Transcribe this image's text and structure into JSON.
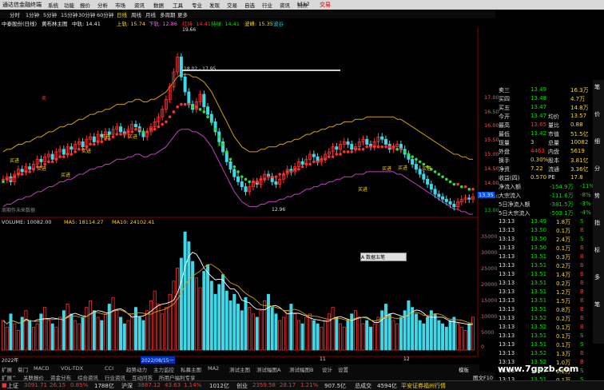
{
  "window": {
    "title": "通达信金融终端",
    "right_label": "交易",
    "menus": [
      "系统",
      "功能",
      "报价",
      "分析",
      "市场",
      "资讯",
      "数据",
      "工具",
      "专业",
      "发现",
      "交易",
      "自选",
      "行业",
      "资讯",
      "热点",
      "L1L2"
    ]
  },
  "periods": [
    "分时",
    "1分钟",
    "5分钟",
    "15分钟",
    "30分钟",
    "60分钟",
    "日线",
    "周线",
    "月线",
    "多周期",
    "更多"
  ],
  "stock_header": {
    "name": "中泰股份(日线)",
    "indicator": "黄布林主图",
    "mid_label": "中轨: 14.41",
    "upper_label": "上轨: 15.74",
    "lower_label": "下轨: 12.86",
    "red_label": "红持: 14.41",
    "green_label": "持绿: 14.41",
    "wave_label": "波峰: 15.35",
    "extra_label": "波谷"
  },
  "price_axis": [
    "17.00",
    "16.50",
    "16.00",
    "15.50",
    "15.00",
    "14.50",
    "14.00",
    "13.50",
    "13.00"
  ],
  "current_price_tag": "13.35",
  "annotations": {
    "high": "19.66",
    "range": "18.02 - 17.95",
    "low": "12.96",
    "buy_labels": [
      "买进",
      "买进",
      "买进",
      "买进",
      "买进",
      "买进",
      "买进",
      "买进",
      "买进",
      "买进"
    ],
    "sell_labels": [
      "卖",
      "卖"
    ],
    "note": "周期作未来数据"
  },
  "volume_header": {
    "volume": "VOLUME: 10082.00",
    "ma5": "MA5: 18114.27",
    "ma10": "MA10: 24102.41"
  },
  "volume_axis": [
    "35000",
    "30000",
    "25000",
    "20000",
    "15000",
    "10000",
    "5000",
    "0"
  ],
  "date_labels": {
    "left": "2022年",
    "middle": "2022/08/15一",
    "m2": "11",
    "m3": "12"
  },
  "popup": "A 数据五笔",
  "chart_data": {
    "type": "bar",
    "title": "",
    "categories": [],
    "ylabel": "",
    "ylim": [
      0,
      38000
    ],
    "series": [
      {
        "name": "VOLUME",
        "values": [
          9000,
          7000,
          11000,
          8000,
          6000,
          10000,
          12000,
          9000,
          7000,
          8000,
          11000,
          13000,
          9000,
          8000,
          7000,
          10000,
          12000,
          14000,
          11000,
          9000,
          8000,
          10000,
          13000,
          15000,
          12000,
          10000,
          9000,
          11000,
          14000,
          16000,
          12000,
          10000,
          8000,
          9000,
          11000,
          13000,
          10000,
          9000,
          12000,
          15000,
          18000,
          14000,
          11000,
          13000,
          17000,
          21000,
          25000,
          28000,
          36000,
          33000,
          27000,
          22000,
          19000,
          24000,
          26000,
          21000,
          17000,
          20000,
          23000,
          18000,
          15000,
          17000,
          14000,
          12000,
          16000,
          13000,
          11000,
          10000,
          12000,
          15000,
          17000,
          13000,
          11000,
          9000,
          10000,
          12000,
          14000,
          11000,
          9000,
          8000,
          10000,
          11000,
          9000,
          8000,
          7000,
          9000,
          11000,
          13000,
          10000,
          8000,
          7000,
          9000,
          11000,
          12000,
          10000,
          8000,
          9000,
          7000,
          8000,
          10000,
          12000,
          14000,
          11000,
          9000,
          8000,
          10000,
          12000,
          15000,
          13000,
          11000,
          9000,
          8000,
          10000,
          12000,
          11000,
          9000,
          8000,
          7000,
          9000,
          10000,
          8000,
          7000,
          6000,
          8000,
          10000
        ]
      }
    ],
    "up_colors": {
      "up": "#ff3030",
      "down": "#40d8e8"
    },
    "price": {
      "ylim": [
        12.7,
        20.0
      ],
      "close": [
        14.1,
        14.2,
        14.0,
        14.3,
        14.5,
        14.4,
        14.6,
        14.5,
        14.7,
        14.9,
        14.8,
        15.0,
        15.1,
        14.9,
        15.2,
        15.3,
        15.1,
        15.4,
        15.3,
        15.5,
        15.6,
        15.4,
        15.7,
        15.8,
        15.6,
        15.9,
        15.8,
        16.0,
        15.9,
        16.1,
        16.2,
        16.0,
        15.9,
        16.1,
        16.3,
        16.2,
        16.0,
        15.8,
        16.0,
        16.2,
        16.4,
        16.6,
        16.9,
        17.3,
        17.8,
        18.4,
        19.0,
        18.2,
        17.6,
        17.1,
        16.9,
        17.2,
        17.5,
        17.0,
        16.7,
        16.4,
        16.0,
        15.6,
        15.2,
        14.8,
        14.5,
        14.2,
        14.0,
        13.8,
        13.6,
        13.8,
        14.0,
        13.9,
        14.1,
        14.3,
        14.2,
        14.0,
        13.9,
        14.1,
        14.3,
        14.5,
        14.4,
        14.6,
        14.8,
        14.7,
        14.9,
        15.1,
        15.0,
        14.8,
        14.9,
        15.1,
        15.2,
        15.4,
        15.3,
        15.5,
        15.6,
        15.5,
        15.3,
        15.4,
        15.6,
        15.7,
        15.5,
        15.4,
        15.6,
        15.8,
        15.7,
        15.5,
        15.3,
        15.4,
        15.5,
        15.3,
        15.1,
        14.9,
        14.7,
        14.5,
        14.3,
        14.1,
        13.9,
        13.7,
        13.5,
        13.4,
        13.3,
        13.2,
        13.1,
        13.0,
        13.2,
        13.3,
        13.35,
        13.3,
        13.4
      ],
      "mid_band": [
        14.0,
        14.1,
        14.1,
        14.2,
        14.3,
        14.3,
        14.4,
        14.4,
        14.5,
        14.6,
        14.6,
        14.7,
        14.8,
        14.8,
        14.9,
        15.0,
        15.0,
        15.1,
        15.1,
        15.2,
        15.3,
        15.3,
        15.4,
        15.5,
        15.5,
        15.6,
        15.6,
        15.7,
        15.7,
        15.8,
        15.9,
        15.9,
        15.9,
        16.0,
        16.0,
        16.1,
        16.1,
        16.0,
        16.0,
        16.1,
        16.1,
        16.2,
        16.3,
        16.4,
        16.6,
        16.8,
        17.0,
        17.1,
        17.1,
        17.1,
        17.0,
        17.0,
        16.9,
        16.8,
        16.6,
        16.4,
        16.1,
        15.8,
        15.5,
        15.2,
        14.9,
        14.6,
        14.4,
        14.2,
        14.1,
        14.0,
        14.0,
        14.0,
        14.1,
        14.1,
        14.2,
        14.2,
        14.2,
        14.3,
        14.3,
        14.4,
        14.4,
        14.5,
        14.5,
        14.6,
        14.7,
        14.7,
        14.8,
        14.8,
        14.9,
        14.9,
        15.0,
        15.0,
        15.1,
        15.1,
        15.2,
        15.2,
        15.2,
        15.3,
        15.3,
        15.3,
        15.4,
        15.4,
        15.4,
        15.4,
        15.4,
        15.4,
        15.4,
        15.4,
        15.3,
        15.3,
        15.2,
        15.1,
        15.0,
        14.9,
        14.8,
        14.7,
        14.6,
        14.5,
        14.4,
        14.3,
        14.2,
        14.1,
        14.0,
        13.9,
        13.9,
        13.8,
        13.8,
        13.7,
        13.7
      ]
    }
  },
  "quote_panel": {
    "rows": [
      {
        "label": "卖三",
        "price": "13.49",
        "vol": "16.3万",
        "price_color": "#00e000"
      },
      {
        "label": "买四",
        "price": "13.48",
        "vol": "4.7万",
        "price_color": "#00e000"
      },
      {
        "label": "买五",
        "price": "13.47",
        "vol": "14.8万",
        "price_color": "#00e000"
      },
      {
        "label": "今开",
        "price": "13.47",
        "vol_label": "均价",
        "vol": "13.57",
        "price_color": "#00e000"
      },
      {
        "label": "最高",
        "price": "13.65",
        "vol_label": "量比",
        "vol": "0.88",
        "price_color": "#ff3030"
      },
      {
        "label": "最低",
        "price": "13.42",
        "vol_label": "市值",
        "vol": "51.5亿",
        "price_color": "#00e000"
      },
      {
        "label": "现量",
        "price": "3",
        "vol_label": "总量",
        "vol": "10082",
        "price_color": "#ffd700"
      },
      {
        "label": "外盘",
        "price": "4463",
        "vol_label": "内盘",
        "vol": "5619",
        "price_color": "#ff3030"
      },
      {
        "label": "换手",
        "price": "0.30%",
        "vol_label": "股本",
        "vol": "3.81亿",
        "price_color": "#ffd700"
      },
      {
        "label": "净资",
        "price": "7.22",
        "vol_label": "流通",
        "vol": "3.36亿",
        "price_color": "#ffd700"
      },
      {
        "label": "收益(四)",
        "price": "0.570",
        "vol_label": "PE",
        "vol": "17.8",
        "price_color": "#ffd700"
      }
    ],
    "flows": [
      {
        "label": "净流入额",
        "value": "-154.9万",
        "pct": "-11%"
      },
      {
        "label": "大宗流入",
        "value": "-111.6万",
        "pct": "-8%"
      },
      {
        "label": "5日净流入额",
        "value": "-381.5万",
        "pct": "-3%"
      },
      {
        "label": "5日大宗流入",
        "value": "-503.1万",
        "pct": "-4%"
      }
    ],
    "ticks": [
      {
        "time": "13:13",
        "price": "13.49",
        "vol": "1.8万",
        "dir": "S"
      },
      {
        "time": "13:13",
        "price": "13.50",
        "vol": "0.1万",
        "dir": "B"
      },
      {
        "time": "13:13",
        "price": "13.50",
        "vol": "2.4万",
        "dir": "S"
      },
      {
        "time": "13:13",
        "price": "13.50",
        "vol": "0.1万",
        "dir": "B"
      },
      {
        "time": "13:13",
        "price": "13.51",
        "vol": "0.3万",
        "dir": "B"
      },
      {
        "time": "13:13",
        "price": "13.51",
        "vol": "0.2万",
        "dir": "B"
      },
      {
        "time": "13:13",
        "price": "13.51",
        "vol": "1.4万",
        "dir": "B"
      },
      {
        "time": "13:13",
        "price": "13.51",
        "vol": "0.2万",
        "dir": "B"
      },
      {
        "time": "13:13",
        "price": "13.51",
        "vol": "1.2万",
        "dir": "B"
      },
      {
        "time": "13:13",
        "price": "13.51",
        "vol": "1.5万",
        "dir": "B"
      },
      {
        "time": "13:13",
        "price": "13.51",
        "vol": "0.8万",
        "dir": "B"
      },
      {
        "time": "13:13",
        "price": "13.52",
        "vol": "0.2万",
        "dir": "B"
      },
      {
        "time": "13:13",
        "price": "13.52",
        "vol": "0.1万",
        "dir": "B"
      },
      {
        "time": "13:13",
        "price": "13.51",
        "vol": "0.1万",
        "dir": "S"
      },
      {
        "time": "13:13",
        "price": "13.51",
        "vol": "0.1万",
        "dir": "S"
      },
      {
        "time": "13:13",
        "price": "13.52",
        "vol": "1.3万",
        "dir": "B"
      },
      {
        "time": "13:13",
        "price": "13.52",
        "vol": "1.0万",
        "dir": "B"
      },
      {
        "time": "13:13",
        "price": "13.51",
        "vol": "0.2万",
        "dir": "S"
      },
      {
        "time": "13:13",
        "price": "13.51",
        "vol": "0.1万",
        "dir": "S"
      }
    ]
  },
  "right_strip": [
    "笔",
    "价",
    "细",
    "分",
    "势",
    "指",
    "标",
    "多",
    "笔"
  ],
  "tabs_row1": [
    "扩展",
    "菊门",
    "MACD",
    "VOL-TDX",
    "CCI",
    "趋势动力",
    "主力监控",
    "私募主图",
    "MA2",
    "测试主图",
    "测试幅图A",
    "测试幅图B",
    "设计",
    "设置"
  ],
  "tabs_row1_right": "模板",
  "tabs_row2": [
    "扩展^",
    "关联报价",
    "资金分布",
    "综合资讯",
    "行业资讯",
    "互动问答",
    "所用户福利专享"
  ],
  "tabs_row2_right": "图文F10",
  "statusbar": {
    "sh_label": "上证",
    "sh_value": "3091.71",
    "sh_chg": "26.15",
    "sh_pct": "0.85%",
    "sh_amt": "1788亿",
    "sz_label": "沪深",
    "sz_value": "3887.12",
    "sz_chg": "43.63",
    "sz_pct": "1.14%",
    "sz_amt": "1012亿",
    "cy_label": "创业",
    "cy_value": "2359.58",
    "cy_chg": "28.17",
    "cy_pct": "1.21%",
    "cy_amt": "907.5亿",
    "total_label": "总成交",
    "total_value": "4594亿",
    "broker": "平安证券福州行情"
  },
  "watermark": "www.7gpzb.com"
}
